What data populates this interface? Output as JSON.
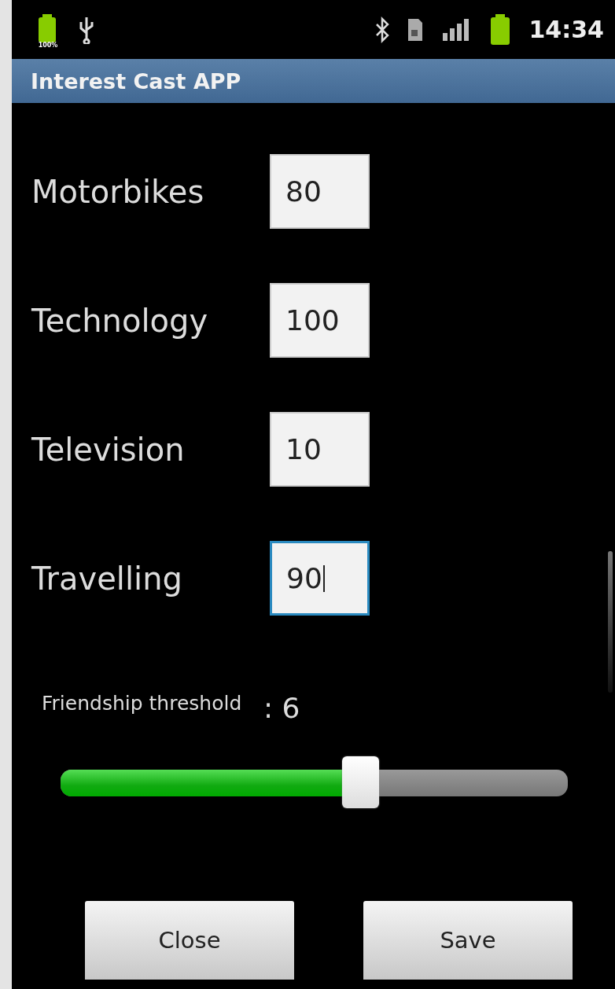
{
  "status_bar": {
    "battery_label": "100%",
    "time": "14:34"
  },
  "title_bar": {
    "title": "Interest Cast APP"
  },
  "interests": [
    {
      "label": "Motorbikes",
      "value": "80",
      "focused": false
    },
    {
      "label": "Technology",
      "value": "100",
      "focused": false
    },
    {
      "label": "Television",
      "value": "10",
      "focused": false
    },
    {
      "label": "Travelling",
      "value": "90",
      "focused": true
    }
  ],
  "threshold": {
    "label": "Friendship threshold",
    "reading": ": 6",
    "level": 0.59
  },
  "buttons": [
    "Close",
    "Save"
  ]
}
